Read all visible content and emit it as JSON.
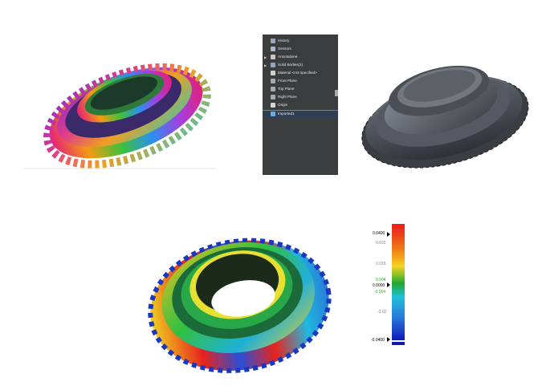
{
  "feature_tree": {
    "items": [
      {
        "label": "History",
        "icon": "history-icon",
        "expander": false
      },
      {
        "label": "Sensors",
        "icon": "sensors-icon",
        "expander": false
      },
      {
        "label": "Annotations",
        "icon": "annotations-icon",
        "expander": true
      },
      {
        "label": "Solid Bodies(1)",
        "icon": "solid-bodies-icon",
        "expander": true
      },
      {
        "label": "Material <not specified>",
        "icon": "material-icon",
        "expander": false
      },
      {
        "label": "Front Plane",
        "icon": "plane-icon",
        "expander": false
      },
      {
        "label": "Top Plane",
        "icon": "plane-icon",
        "expander": false
      },
      {
        "label": "Right Plane",
        "icon": "plane-icon",
        "expander": false
      },
      {
        "label": "Origin",
        "icon": "origin-icon",
        "expander": false
      },
      {
        "label": "Imported1",
        "icon": "imported-body-icon",
        "expander": false
      }
    ]
  },
  "deviation_legend": {
    "max_label": "0.0400",
    "min_label": "-0.0400",
    "zero_label": "0.0000",
    "ticks": [
      "0.032",
      "0.016",
      "0.004",
      "-0.004",
      "-0.02"
    ],
    "upper_color": "#e8231c",
    "zero_color": "#20a830",
    "lower_color": "#1018b8",
    "tolerance_text_color": "#2eaa2e"
  }
}
